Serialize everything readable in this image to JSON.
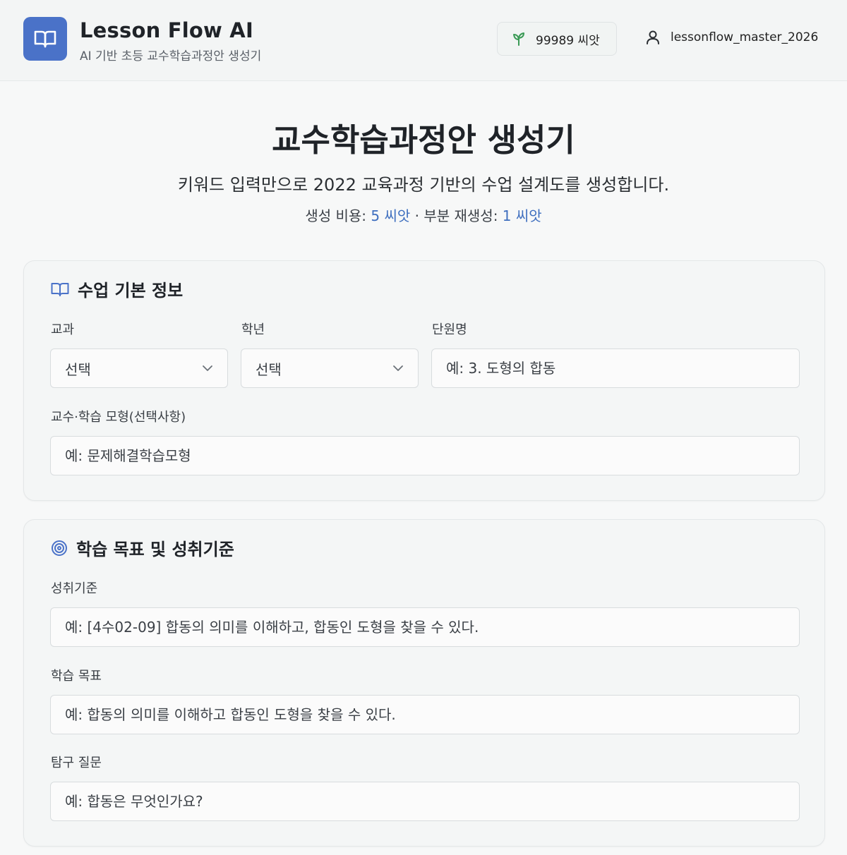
{
  "header": {
    "app_name": "Lesson Flow AI",
    "app_subtitle": "AI 기반 초등 교수학습과정안 생성기",
    "seed_balance": "99989 씨앗",
    "username": "lessonflow_master_2026"
  },
  "hero": {
    "title": "교수학습과정안 생성기",
    "description": "키워드 입력만으로 2022 교육과정 기반의 수업 설계도를 생성합니다.",
    "cost_prefix": "생성 비용:",
    "cost_value": "5 씨앗",
    "cost_separator": "· 부분 재생성:",
    "regen_value": "1 씨앗"
  },
  "basic_info": {
    "title": "수업 기본 정보",
    "subject": {
      "label": "교과",
      "selected": "선택"
    },
    "grade": {
      "label": "학년",
      "selected": "선택"
    },
    "unit": {
      "label": "단원명",
      "placeholder": "예: 3. 도형의 합동"
    },
    "model": {
      "label": "교수·학습 모형(선택사항)",
      "placeholder": "예: 문제해결학습모형"
    }
  },
  "objectives": {
    "title": "학습 목표 및 성취기준",
    "standard": {
      "label": "성취기준",
      "placeholder": "예: [4수02-09] 합동의 의미를 이해하고, 합동인 도형을 찾을 수 있다."
    },
    "goal": {
      "label": "학습 목표",
      "placeholder": "예: 합동의 의미를 이해하고 합동인 도형을 찾을 수 있다."
    },
    "question": {
      "label": "탐구 질문",
      "placeholder": "예: 합동은 무엇인가요?"
    }
  },
  "icons": {
    "logo": "book-open-icon",
    "seed": "sprout-icon",
    "user": "user-icon",
    "basic_info": "book-open-icon",
    "objectives": "target-icon",
    "select": "chevron-down-icon"
  },
  "colors": {
    "accent": "#4a72c8",
    "seed_green": "#3a9a55",
    "link_blue": "#3f6fbf"
  }
}
